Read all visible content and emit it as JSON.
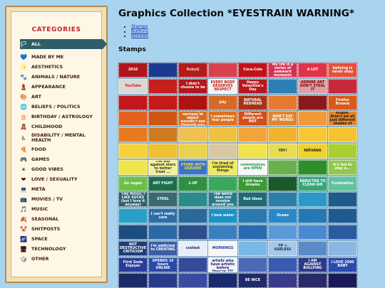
{
  "page_title": "Graphics Collection *EYESTRAIN WARNING*",
  "toc": [
    "Stamps",
    "Buttons",
    "Blinkies"
  ],
  "stamps_heading": "Stamps",
  "sidebar": {
    "title": "CATEGORIES",
    "items": [
      {
        "label": "ALL",
        "icon": "rainbow-flag-icon",
        "glyph": "🏳",
        "active": true
      },
      {
        "label": "MADE BY ME",
        "icon": "heart-icon",
        "glyph": "💙"
      },
      {
        "label": "AESTHETICS",
        "icon": "sparkles-icon",
        "glyph": "✨"
      },
      {
        "label": "ANIMALS / NATURE",
        "icon": "paw-icon",
        "glyph": "🐾"
      },
      {
        "label": "APPEARANCE",
        "icon": "lipstick-icon",
        "glyph": "💄"
      },
      {
        "label": "ART",
        "icon": "palette-icon",
        "glyph": "🎨"
      },
      {
        "label": "BELIEFS / POLITICS",
        "icon": "globe-icon",
        "glyph": "🌐"
      },
      {
        "label": "BIRTHDAY / ASTROLOGY",
        "icon": "cake-icon",
        "glyph": "🎂"
      },
      {
        "label": "CHILDHOOD",
        "icon": "rubber-duck-icon",
        "glyph": "🧸"
      },
      {
        "label": "DISABILITY / MENTAL HEALTH",
        "icon": "wheelchair-icon",
        "glyph": "♿"
      },
      {
        "label": "FOOD",
        "icon": "pizza-icon",
        "glyph": "🍕"
      },
      {
        "label": "GAMES",
        "icon": "gamepad-icon",
        "glyph": "🎮"
      },
      {
        "label": "GOOD VIBES",
        "icon": "sun-icon",
        "glyph": "☀"
      },
      {
        "label": "LOVE / SEXUALITY",
        "icon": "red-heart-icon",
        "glyph": "❤"
      },
      {
        "label": "META",
        "icon": "computer-icon",
        "glyph": "💻"
      },
      {
        "label": "MOVIES / TV",
        "icon": "tv-icon",
        "glyph": "📺"
      },
      {
        "label": "MUSIC",
        "icon": "music-note-icon",
        "glyph": "🎵"
      },
      {
        "label": "SEASONAL",
        "icon": "leaf-icon",
        "glyph": "🍂"
      },
      {
        "label": "SHITPOSTS",
        "icon": "face-icon",
        "glyph": "🤡"
      },
      {
        "label": "SPACE",
        "icon": "stars-icon",
        "glyph": "🌌"
      },
      {
        "label": "TECHNOLOGY",
        "icon": "laptop-icon",
        "glyph": "🖥"
      },
      {
        "label": "OTHER",
        "icon": "box-icon",
        "glyph": "🎲"
      }
    ]
  },
  "stamps": [
    {
      "text": "2010",
      "bg": "#b0141c",
      "fg": "#ffffff"
    },
    {
      "text": "",
      "bg": "#1c3a8f",
      "fg": "#ffffff"
    },
    {
      "text": "RubyQ",
      "bg": "#b21c1c",
      "fg": "#ffd0d0"
    },
    {
      "text": "",
      "bg": "#d94050",
      "fg": "#ffffff"
    },
    {
      "text": "Coca-Cola",
      "bg": "#c3121c",
      "fg": "#ffffff"
    },
    {
      "text": "My life is a series of awkward moments",
      "bg": "#d63054",
      "fg": "#ffffff"
    },
    {
      "text": "A LOT",
      "bg": "#e0334a",
      "fg": "#ffffff"
    },
    {
      "text": "ballying is never okay",
      "bg": "#e6503a",
      "fg": "#ffffff"
    },
    {
      "text": "YouTube",
      "bg": "#d8d8d8",
      "fg": "#cc1f1f"
    },
    {
      "text": "",
      "bg": "#c71e1e",
      "fg": "#ffffff"
    },
    {
      "text": "I didn't choose to be",
      "bg": "#b4151c",
      "fg": "#ffffff"
    },
    {
      "text": "EVERY BODY DESERVES RESPECT",
      "bg": "#f3f3f3",
      "fg": "#c41818"
    },
    {
      "text": "Happy Valentine's Day",
      "bg": "#b9161f",
      "fg": "#ffffff"
    },
    {
      "text": "",
      "bg": "#2b7fb5",
      "fg": "#ffffff"
    },
    {
      "text": "ADMIRE ART DON'T STEAL IT",
      "bg": "#d8a0a8",
      "fg": "#800000"
    },
    {
      "text": "",
      "bg": "#c8283c",
      "fg": "#ffffff"
    },
    {
      "text": "",
      "bg": "#c0181c",
      "fg": "#ffffff"
    },
    {
      "text": "",
      "bg": "#c61a1a",
      "fg": "#ffffff"
    },
    {
      "text": "",
      "bg": "#b01212",
      "fg": "#ffffff"
    },
    {
      "text": "July",
      "bg": "#d46a2a",
      "fg": "#ffffff"
    },
    {
      "text": "NATURAL REDHEAD",
      "bg": "#a83218",
      "fg": "#ffffff"
    },
    {
      "text": "",
      "bg": "#e37a30",
      "fg": "#ffffff"
    },
    {
      "text": "",
      "bg": "#8a1a1a",
      "fg": "#ffffff"
    },
    {
      "text": "Firefox Browse",
      "bg": "#d9591a",
      "fg": "#ffffff"
    },
    {
      "text": "",
      "bg": "#e55f1e",
      "fg": "#ffffff"
    },
    {
      "text": "",
      "bg": "#cf5612",
      "fg": "#ffffff"
    },
    {
      "text": "Getting nervous at object wouldn't see through you",
      "bg": "#d66d1e",
      "fg": "#ffffff"
    },
    {
      "text": "I sometimes fear people",
      "bg": "#e1701a",
      "fg": "#ffffff"
    },
    {
      "text": "Different people are NOT",
      "bg": "#d24e1a",
      "fg": "#ffffff"
    },
    {
      "text": "DON'T EAT MY WORDS",
      "bg": "#e2842a",
      "fg": "#ffffff"
    },
    {
      "text": "",
      "bg": "#f09a3a",
      "fg": "#ffffff"
    },
    {
      "text": "Racism is stupid. Aren't we all just different shades of tan?",
      "bg": "#e0862b",
      "fg": "#1b1b1b"
    },
    {
      "text": "",
      "bg": "#e8791c",
      "fg": "#ffffff"
    },
    {
      "text": "",
      "bg": "#cf7a20",
      "fg": "#ffffff"
    },
    {
      "text": "",
      "bg": "#f0c050",
      "fg": "#ffffff"
    },
    {
      "text": "",
      "bg": "#f0c040",
      "fg": "#ffffff"
    },
    {
      "text": "",
      "bg": "#f2a53a",
      "fg": "#ffffff"
    },
    {
      "text": "",
      "bg": "#f0b330",
      "fg": "#ffffff"
    },
    {
      "text": "",
      "bg": "#f8c834",
      "fg": "#333333"
    },
    {
      "text": "",
      "bg": "#f4c430",
      "fg": "#333333"
    },
    {
      "text": "",
      "bg": "#f5d23c",
      "fg": "#333333"
    },
    {
      "text": "",
      "bg": "#efc030",
      "fg": "#333333"
    },
    {
      "text": "",
      "bg": "#e9d24c",
      "fg": "#333333"
    },
    {
      "text": "",
      "bg": "#d8c8a0",
      "fg": "#333333"
    },
    {
      "text": "",
      "bg": "#f2e34c",
      "fg": "#333333"
    },
    {
      "text": "YAY!",
      "bg": "#e7dc52",
      "fg": "#333333"
    },
    {
      "text": "NIRVANA",
      "bg": "#f0d22a",
      "fg": "#222222"
    },
    {
      "text": "",
      "bg": "#a8d030",
      "fg": "#333333"
    },
    {
      "text": "",
      "bg": "#f0e44c",
      "fg": "#333333"
    },
    {
      "text": "The war against stars to better treat ...",
      "bg": "#f5f093",
      "fg": "#333333"
    },
    {
      "text": "STAND WITH UKRAINE",
      "bg": "#3a74c8",
      "fg": "#f5de28"
    },
    {
      "text": "I'm tired of explaining things",
      "bg": "#f0e95a",
      "fg": "#333333"
    },
    {
      "text": "commissions are OPEN",
      "bg": "#f7f7f7",
      "fg": "#1a9a3a"
    },
    {
      "text": "",
      "bg": "#6ab04c",
      "fg": "#ffffff"
    },
    {
      "text": "",
      "bg": "#2c8f2c",
      "fg": "#ffffff"
    },
    {
      "text": "It's fun to stay a...",
      "bg": "#92c84e",
      "fg": "#ffffff"
    },
    {
      "text": "Go vegan",
      "bg": "#6cc04a",
      "fg": "#ffffff"
    },
    {
      "text": "ART FIGHT",
      "bg": "#1e6e4e",
      "fg": "#ffffff"
    },
    {
      "text": "1-UP",
      "bg": "#2f8f42",
      "fg": "#ffffff"
    },
    {
      "text": "",
      "bg": "#3aa85a",
      "fg": "#ffffff"
    },
    {
      "text": "I still have dreams",
      "bg": "#3a9a36",
      "fg": "#ffffff"
    },
    {
      "text": "",
      "bg": "#1a5a2a",
      "fg": "#ffffff"
    },
    {
      "text": "ADDICTED TO CLEAN AIR",
      "bg": "#3aa57a",
      "fg": "#ffffff"
    },
    {
      "text": "Funduation",
      "bg": "#62c2a0",
      "fg": "#ffffff"
    },
    {
      "text": "THE MUSIC I LIKE SUCKS (but I love it anyway)",
      "bg": "#2e5f6e",
      "fg": "#ffffff"
    },
    {
      "text": "STEAL",
      "bg": "#3a6a70",
      "fg": "#ffffff"
    },
    {
      "text": "",
      "bg": "#2c8a8a",
      "fg": "#ffffff"
    },
    {
      "text": "The world does not revolve around you",
      "bg": "#2a7a8c",
      "fg": "#ffffff"
    },
    {
      "text": "Bad Ideas",
      "bg": "#1f6a74",
      "fg": "#ffffff"
    },
    {
      "text": "",
      "bg": "#2c7ea8",
      "fg": "#ffffff"
    },
    {
      "text": "",
      "bg": "#2c98c8",
      "fg": "#ffffff"
    },
    {
      "text": "",
      "bg": "#1e5a8a",
      "fg": "#ffffff"
    },
    {
      "text": "",
      "bg": "#2aa0c8",
      "fg": "#ffffff"
    },
    {
      "text": "I can't really care",
      "bg": "#2b6fa8",
      "fg": "#ffffff"
    },
    {
      "text": "",
      "bg": "#2a6a9a",
      "fg": "#ffffff"
    },
    {
      "text": "I love water",
      "bg": "#1e90c4",
      "fg": "#ffffff"
    },
    {
      "text": "",
      "bg": "#2a7ab0",
      "fg": "#ffffff"
    },
    {
      "text": "Ocean",
      "bg": "#2c88c4",
      "fg": "#ffffff"
    },
    {
      "text": "",
      "bg": "#2678b5",
      "fg": "#ffffff"
    },
    {
      "text": "",
      "bg": "#1e5a90",
      "fg": "#ffffff"
    },
    {
      "text": "",
      "bg": "#1c4c80",
      "fg": "#ffffff"
    },
    {
      "text": "",
      "bg": "#2a68a8",
      "fg": "#ffffff"
    },
    {
      "text": "",
      "bg": "#2a4f8a",
      "fg": "#ffffff"
    },
    {
      "text": "",
      "bg": "#3a7fc0",
      "fg": "#ffffff"
    },
    {
      "text": "",
      "bg": "#2a6ab0",
      "fg": "#ffffff"
    },
    {
      "text": "",
      "bg": "#5a9ad8",
      "fg": "#ffffff"
    },
    {
      "text": "",
      "bg": "#4a8ad0",
      "fg": "#ffffff"
    },
    {
      "text": "",
      "bg": "#2a5aa0",
      "fg": "#ffffff"
    },
    {
      "text": "NOT DESTRUCTIVE CRITICISM",
      "bg": "#1e3c7a",
      "fg": "#ffffff"
    },
    {
      "text": "I'm addicted to CREATING",
      "bg": "#3a5ea8",
      "fg": "#ffffff"
    },
    {
      "text": "coolest",
      "bg": "#e8eef8",
      "fg": "#1a2a60"
    },
    {
      "text": "MORNINGS",
      "bg": "#f6f6f6",
      "fg": "#2a3a9a"
    },
    {
      "text": "",
      "bg": "#7ab8e8",
      "fg": "#ffffff"
    },
    {
      "text": "TP = USELESS",
      "bg": "#a8c8e8",
      "fg": "#1a2a60"
    },
    {
      "text": "",
      "bg": "#5a8ac8",
      "fg": "#ffffff"
    },
    {
      "text": "",
      "bg": "#8ab8e0",
      "fg": "#ffffff"
    },
    {
      "text": "First Soda Enjoyer",
      "bg": "#2a3c9a",
      "fg": "#ffffff"
    },
    {
      "text": "SPENDS 14 hours ONLINE",
      "bg": "#2b4aa8",
      "fg": "#ffffff"
    },
    {
      "text": "",
      "bg": "#334a9a",
      "fg": "#ffffff"
    },
    {
      "text": "I support artists who have artistic before they're 25!",
      "bg": "#f2f4fb",
      "fg": "#1a2060"
    },
    {
      "text": "",
      "bg": "#4a6ab8",
      "fg": "#ffffff"
    },
    {
      "text": "",
      "bg": "#3a5ab0",
      "fg": "#ffffff"
    },
    {
      "text": "I AM AGAINST BULLYING",
      "bg": "#2a3a8a",
      "fg": "#ffffff"
    },
    {
      "text": "I LOVE 2000 BABY",
      "bg": "#2a4ab0",
      "fg": "#ffffff"
    },
    {
      "text": "",
      "bg": "#1a2a6a",
      "fg": "#ffffff"
    },
    {
      "text": "",
      "bg": "#2a3a8a",
      "fg": "#ffffff"
    },
    {
      "text": "",
      "bg": "#3a4aa0",
      "fg": "#ffffff"
    },
    {
      "text": "",
      "bg": "#1a2a70",
      "fg": "#ffffff"
    },
    {
      "text": "BE NICE",
      "bg": "#202a6a",
      "fg": "#ffffff"
    },
    {
      "text": "",
      "bg": "#3a3a8a",
      "fg": "#ffffff"
    },
    {
      "text": "",
      "bg": "#2a2a6a",
      "fg": "#ffffff"
    },
    {
      "text": "",
      "bg": "#1a1a5a",
      "fg": "#ffffff"
    }
  ]
}
